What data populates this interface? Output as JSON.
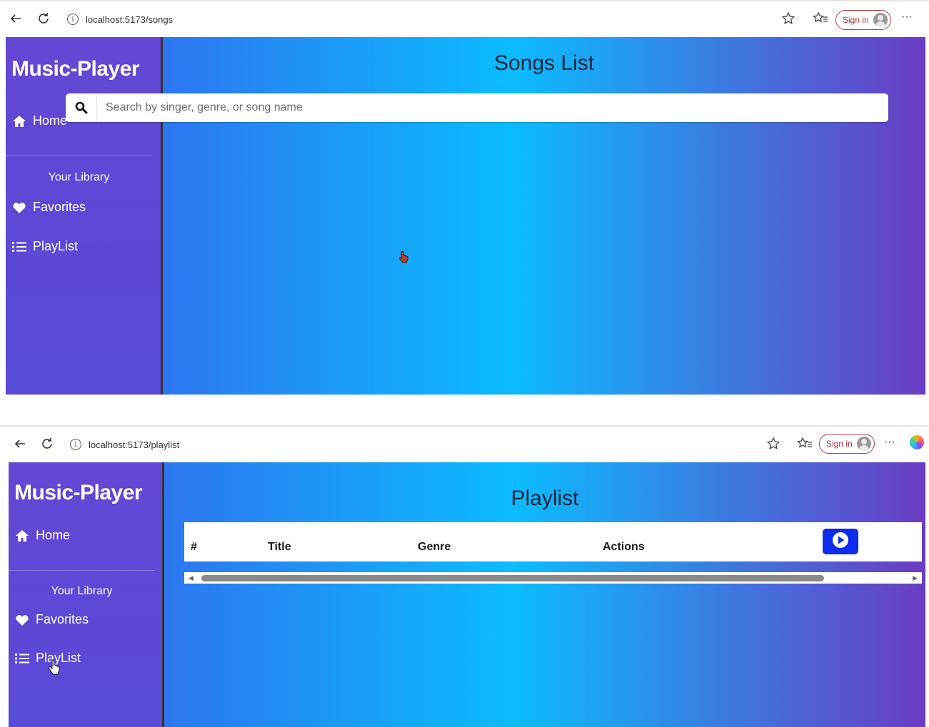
{
  "shot1": {
    "browser": {
      "url": "localhost:5173/songs",
      "sign_in": "Sign in"
    },
    "sidebar": {
      "brand": "Music-Player",
      "home": "Home",
      "library_heading": "Your Library",
      "favorites": "Favorites",
      "playlist": "PlayList"
    },
    "main": {
      "title": "Songs List",
      "search_placeholder": "Search by singer, genre, or song name"
    }
  },
  "shot2": {
    "browser": {
      "url": "localhost:5173/playlist",
      "sign_in": "Sign in"
    },
    "sidebar": {
      "brand": "Music-Player",
      "home": "Home",
      "library_heading": "Your Library",
      "favorites": "Favorites",
      "playlist": "PlayList"
    },
    "main": {
      "title": "Playlist",
      "table_headers": [
        "#",
        "Title",
        "Genre",
        "Actions"
      ]
    }
  },
  "icons": {
    "back": "arrow-left-icon",
    "refresh": "refresh-icon",
    "info": "info-icon",
    "favorite_star": "star-icon",
    "favorites_bar": "favorites-bar-icon",
    "more": "more-dots-icon",
    "home": "home-icon",
    "heart": "heart-icon",
    "list": "list-icon",
    "search": "search-icon",
    "play": "play-circle-icon",
    "copilot": "copilot-icon"
  },
  "colors": {
    "sidebar": "#6547d3",
    "gradient_blue": "#0bbcfd",
    "gradient_indigo": "#3c57ea",
    "gradient_purple": "#6a3cc4",
    "play_button": "#0d2bea",
    "sign_in_border": "#c23b3b"
  }
}
